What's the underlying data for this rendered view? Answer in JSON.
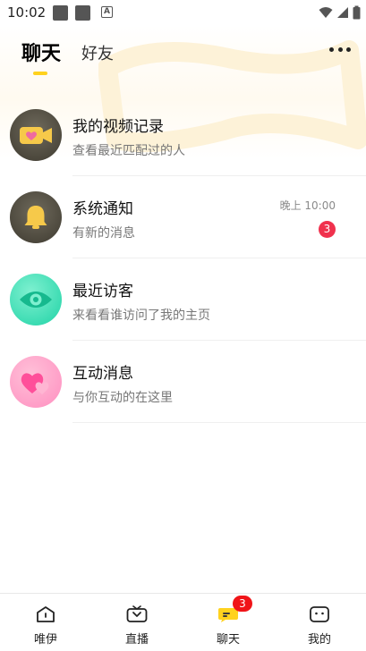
{
  "status_bar": {
    "time": "10:02"
  },
  "header": {
    "tabs": [
      {
        "label": "聊天",
        "active": true
      },
      {
        "label": "好友",
        "active": false
      }
    ]
  },
  "list": [
    {
      "title": "我的视频记录",
      "subtitle": "查看最近匹配过的人",
      "icon": "video-camera-heart-icon"
    },
    {
      "title": "系统通知",
      "subtitle": "有新的消息",
      "time": "晚上 10:00",
      "badge": "3",
      "icon": "bell-icon"
    },
    {
      "title": "最近访客",
      "subtitle": "来看看谁访问了我的主页",
      "icon": "eye-icon"
    },
    {
      "title": "互动消息",
      "subtitle": "与你互动的在这里",
      "icon": "hearts-icon"
    }
  ],
  "bottom_nav": [
    {
      "label": "唯伊",
      "icon": "home-icon"
    },
    {
      "label": "直播",
      "icon": "live-icon"
    },
    {
      "label": "聊天",
      "icon": "chat-icon",
      "badge": "3",
      "active": true
    },
    {
      "label": "我的",
      "icon": "profile-icon"
    }
  ],
  "colors": {
    "accent": "#ffd21e",
    "badge": "#f0314d",
    "nav_badge": "#f01418"
  }
}
